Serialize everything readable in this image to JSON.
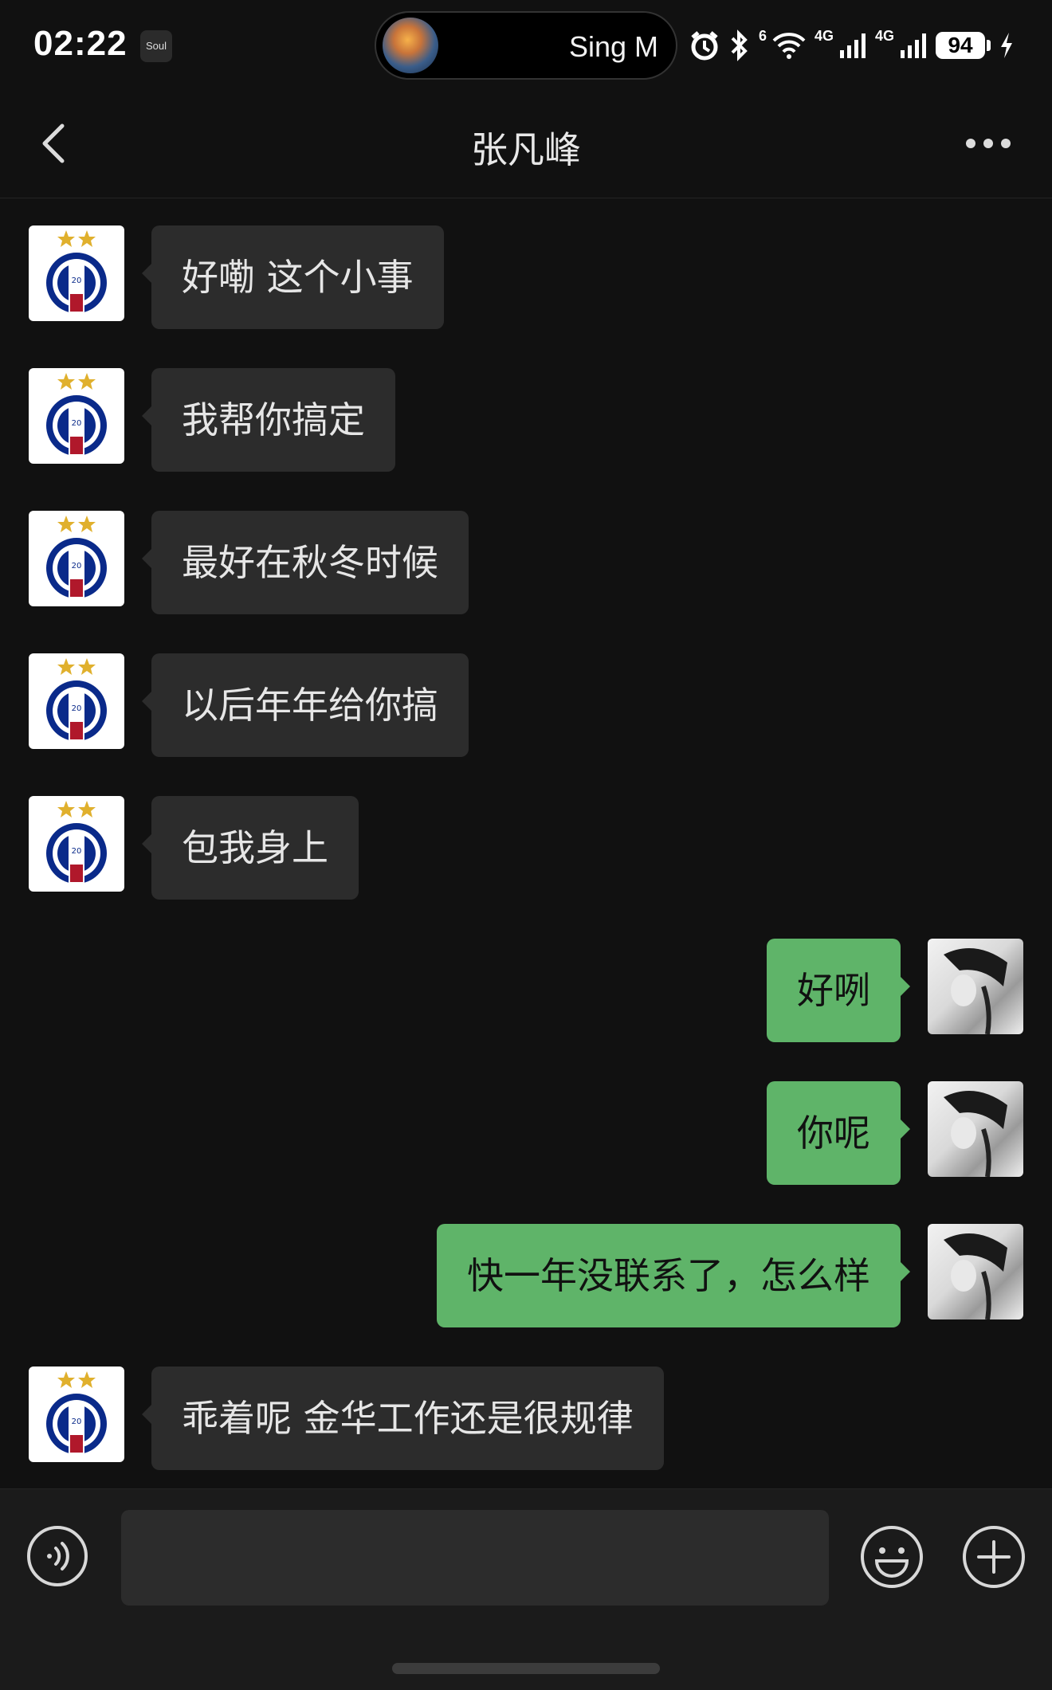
{
  "status_bar": {
    "time": "02:22",
    "app_badge": "Soul",
    "media_title": "Sing M",
    "network_1": "6",
    "network_2": "4G",
    "network_3": "4G",
    "battery": "94",
    "icons": [
      "alarm-icon",
      "bluetooth-icon",
      "wifi-icon",
      "signal-icon",
      "signal-icon",
      "battery-icon",
      "charging-icon"
    ]
  },
  "nav": {
    "title": "张凡峰",
    "back_icon": "chevron-left-icon",
    "more_icon": "more-dots-icon"
  },
  "messages": [
    {
      "from": "contact",
      "text": "好嘞 这个小事"
    },
    {
      "from": "contact",
      "text": "我帮你搞定"
    },
    {
      "from": "contact",
      "text": "最好在秋冬时候"
    },
    {
      "from": "contact",
      "text": "以后年年给你搞"
    },
    {
      "from": "contact",
      "text": "包我身上"
    },
    {
      "from": "me",
      "text": "好咧"
    },
    {
      "from": "me",
      "text": "你呢"
    },
    {
      "from": "me",
      "text": "快一年没联系了，怎么样"
    },
    {
      "from": "contact",
      "text": "乖着呢 金华工作还是很规律"
    }
  ],
  "input": {
    "value": "",
    "placeholder": ""
  },
  "colors": {
    "background": "#111111",
    "incoming_bubble": "#2c2c2c",
    "outgoing_bubble": "#5fb469"
  }
}
